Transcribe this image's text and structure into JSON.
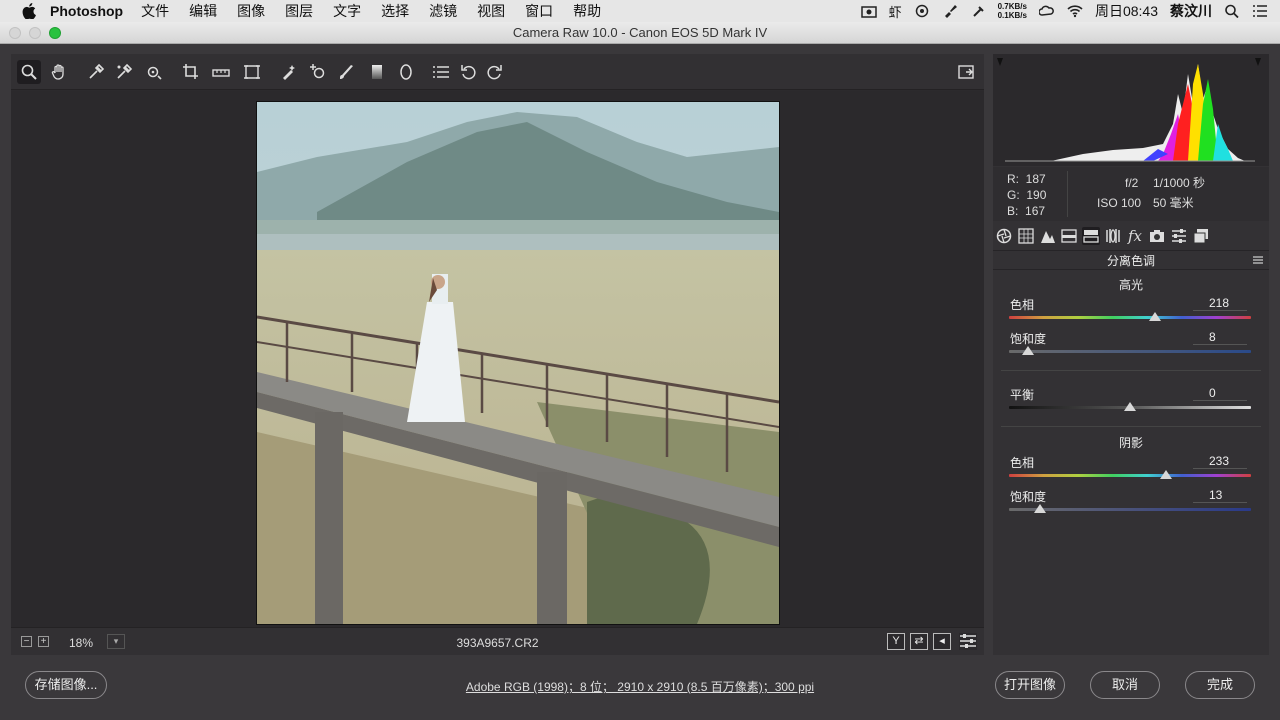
{
  "menubar": {
    "app_name": "Photoshop",
    "menus": [
      "文件",
      "编辑",
      "图像",
      "图层",
      "文字",
      "选择",
      "滤镜",
      "视图",
      "窗口",
      "帮助"
    ],
    "net_up": "0.7KB/s",
    "net_down": "0.1KB/s",
    "clock": "周日08:43",
    "user": "蔡汶川",
    "status_icons": [
      "camera-icon",
      "shrimp-icon",
      "flower-icon",
      "brush-icon",
      "tool-icon",
      "net-speed-icon",
      "cloud-icon",
      "wifi-icon",
      "search-icon",
      "list-icon"
    ]
  },
  "window": {
    "title": "Camera Raw 10.0 -  Canon EOS 5D Mark IV"
  },
  "toolbar": {
    "tools": [
      "zoom-tool",
      "hand-tool",
      "white-balance-tool",
      "color-sampler-tool",
      "targeted-adjustment-tool",
      "crop-tool",
      "straighten-tool",
      "transform-tool",
      "spot-removal-tool",
      "red-eye-tool",
      "adjustment-brush-tool",
      "graduated-filter-tool",
      "radial-filter-tool",
      "presets-list",
      "rotate-ccw",
      "rotate-cw"
    ],
    "active_tool": "zoom-tool"
  },
  "statusbar": {
    "zoom": "18%",
    "filename": "393A9657.CR2"
  },
  "readout": {
    "r_label": "R:",
    "r_value": "187",
    "g_label": "G:",
    "g_value": "190",
    "b_label": "B:",
    "b_value": "167",
    "aperture": "f/2",
    "shutter": "1/1000 秒",
    "iso": "ISO 100",
    "focal": "50 毫米"
  },
  "panel": {
    "title": "分离色调",
    "highlights": {
      "title": "高光",
      "hue_label": "色相",
      "hue_value": "218",
      "hue_level": 0.605,
      "sat_label": "饱和度",
      "sat_value": "8",
      "sat_level": 0.08
    },
    "balance": {
      "label": "平衡",
      "value": "0",
      "level": 0.5
    },
    "shadows": {
      "title": "阴影",
      "hue_label": "色相",
      "hue_value": "233",
      "hue_level": 0.647,
      "sat_label": "饱和度",
      "sat_value": "13",
      "sat_level": 0.13
    }
  },
  "bottom": {
    "save_label": "存储图像...",
    "info": "Adobe RGB (1998)；8 位； 2910 x 2910 (8.5 百万像素)；300 ppi",
    "open_label": "打开图像",
    "cancel_label": "取消",
    "done_label": "完成"
  }
}
